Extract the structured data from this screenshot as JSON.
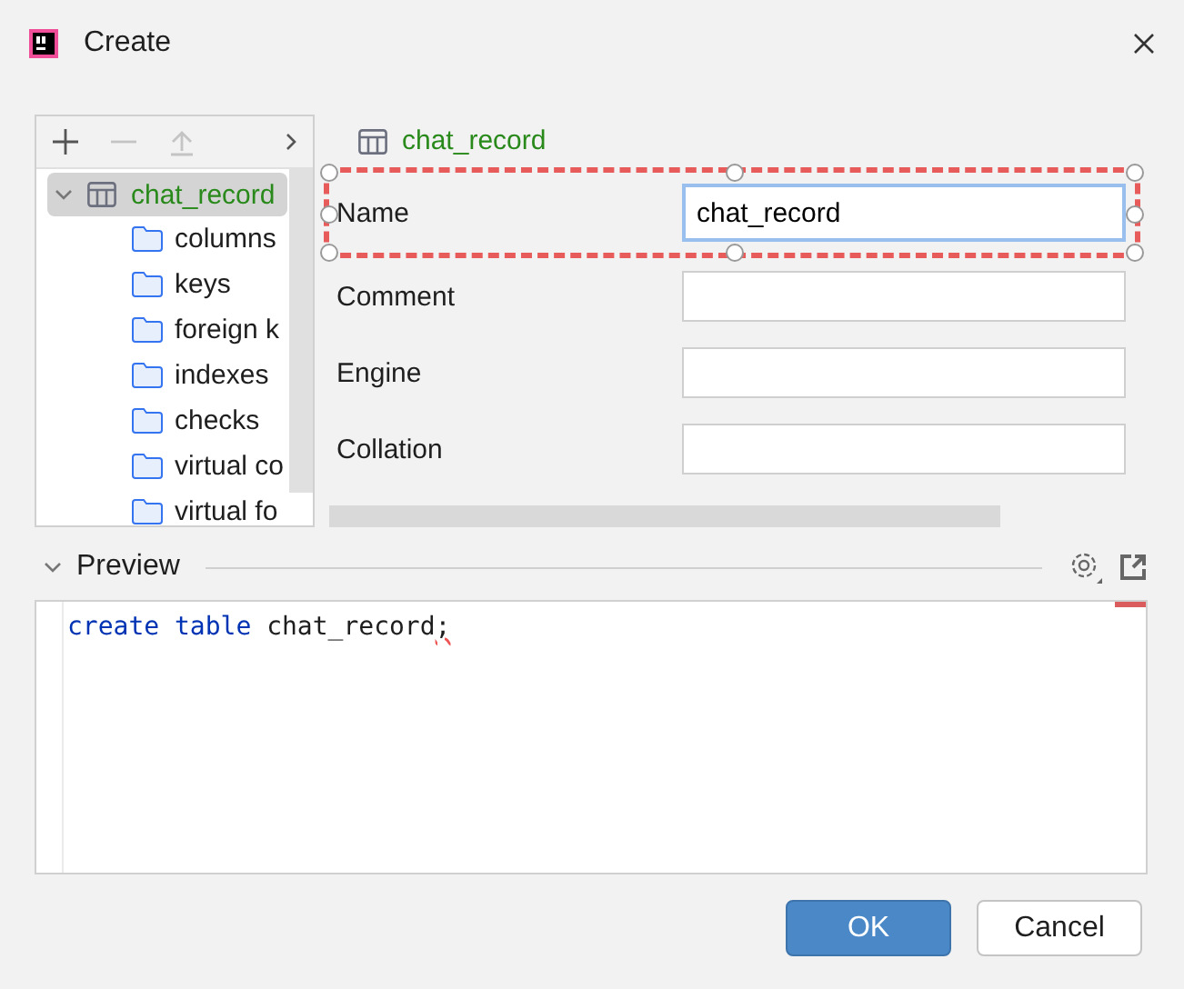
{
  "window": {
    "title": "Create"
  },
  "toolbar": [
    {
      "kind": "add",
      "disabled": false
    },
    {
      "kind": "remove",
      "disabled": true
    },
    {
      "kind": "up",
      "disabled": true
    },
    {
      "kind": "more",
      "disabled": false
    }
  ],
  "tree": {
    "label": "chat_record",
    "expanded": true,
    "selected": true,
    "children": [
      {
        "label": "columns"
      },
      {
        "label": "keys"
      },
      {
        "label": "foreign k"
      },
      {
        "label": "indexes"
      },
      {
        "label": "checks"
      },
      {
        "label": "virtual co"
      },
      {
        "label": "virtual fo"
      }
    ]
  },
  "header": {
    "title": "chat_record"
  },
  "form": {
    "fields": [
      {
        "label": "Name",
        "value": "chat_record",
        "focused": true
      },
      {
        "label": "Comment",
        "focused": false
      },
      {
        "label": "Engine",
        "focused": false
      },
      {
        "label": "Collation",
        "focused": false
      }
    ]
  },
  "preview": {
    "title": "Preview",
    "expanded": true,
    "code": [
      {
        "kind": "keyword",
        "text": "create"
      },
      {
        "kind": "keyword",
        "text": "table"
      },
      {
        "kind": "ident",
        "text": "chat_record"
      },
      {
        "kind": "error",
        "text": ";"
      }
    ]
  },
  "buttons": [
    {
      "label": "OK",
      "default": true
    },
    {
      "label": "Cancel",
      "default": false
    }
  ]
}
